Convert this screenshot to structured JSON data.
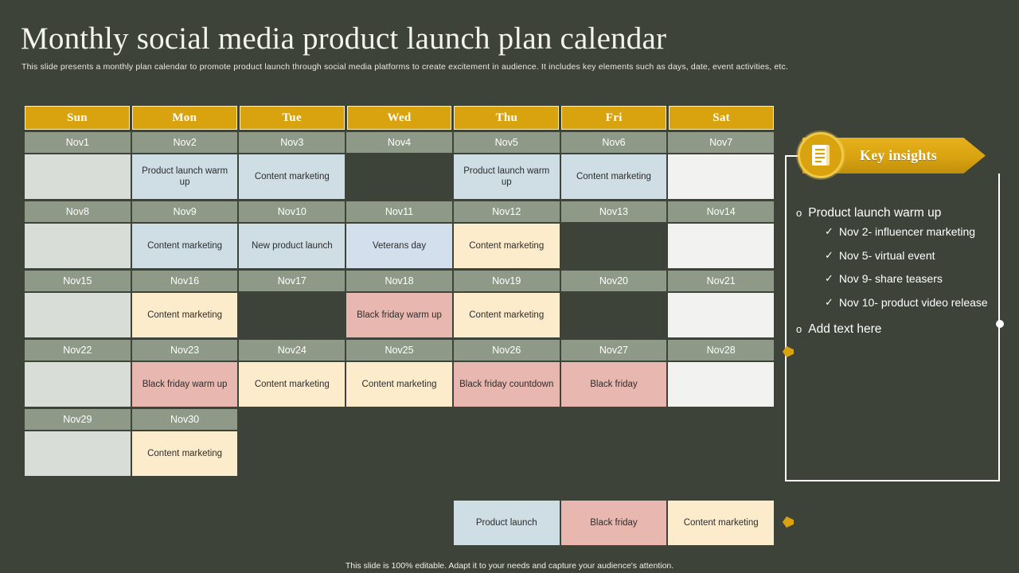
{
  "header": {
    "title": "Monthly social media product launch plan calendar",
    "subtitle": "This slide presents a monthly plan calendar to promote product launch through social media platforms to create excitement in audience. It includes key elements such as days, date, event activities, etc."
  },
  "calendar": {
    "day_headers": [
      "Sun",
      "Mon",
      "Tue",
      "Wed",
      "Thu",
      "Fri",
      "Sat"
    ],
    "weeks": [
      {
        "dates": [
          "Nov1",
          "Nov2",
          "Nov3",
          "Nov4",
          "Nov5",
          "Nov6",
          "Nov7"
        ],
        "events": [
          "",
          "Product launch warm up",
          "Content marketing",
          "",
          "Product launch warm up",
          "Content marketing",
          ""
        ],
        "colors": [
          "c-sun",
          "c-blue",
          "c-blue",
          "c-dark",
          "c-blue",
          "c-blue",
          "c-sat"
        ]
      },
      {
        "dates": [
          "Nov8",
          "Nov9",
          "Nov10",
          "Nov11",
          "Nov12",
          "Nov13",
          "Nov14"
        ],
        "events": [
          "",
          "Content marketing",
          "New product launch",
          "Veterans day",
          "Content marketing",
          "",
          ""
        ],
        "colors": [
          "c-sun",
          "c-blue",
          "c-blue",
          "c-bluer",
          "c-cream",
          "c-dark",
          "c-sat"
        ]
      },
      {
        "dates": [
          "Nov15",
          "Nov16",
          "Nov17",
          "Nov18",
          "Nov19",
          "Nov20",
          "Nov21"
        ],
        "events": [
          "",
          "Content marketing",
          "",
          "Black friday warm up",
          "Content marketing",
          "",
          ""
        ],
        "colors": [
          "c-sun",
          "c-cream",
          "c-dark",
          "c-pink",
          "c-cream",
          "c-dark",
          "c-sat"
        ]
      },
      {
        "dates": [
          "Nov22",
          "Nov23",
          "Nov24",
          "Nov25",
          "Nov26",
          "Nov27",
          "Nov28"
        ],
        "events": [
          "",
          "Black friday warm up",
          "Content marketing",
          "Content marketing",
          "Black friday countdown",
          "Black friday",
          ""
        ],
        "colors": [
          "c-sun",
          "c-pink",
          "c-cream",
          "c-cream",
          "c-pink",
          "c-pink",
          "c-sat"
        ]
      },
      {
        "dates": [
          "Nov29",
          "Nov30",
          "",
          "",
          "",
          "",
          ""
        ],
        "events": [
          "",
          "Content marketing",
          "",
          "",
          "",
          "",
          ""
        ],
        "colors": [
          "c-sun",
          "c-cream",
          "c-dark",
          "c-dark",
          "c-dark",
          "c-dark",
          "c-dark"
        ]
      },
      {
        "dates": [
          "",
          "",
          "",
          "",
          "",
          "",
          ""
        ],
        "events": [
          "",
          "",
          "",
          "",
          "Product launch",
          "Black friday",
          "Content marketing"
        ],
        "colors": [
          "c-dark",
          "c-dark",
          "c-dark",
          "c-dark",
          "c-blue",
          "c-pink",
          "c-cream"
        ]
      }
    ]
  },
  "insights": {
    "banner_label": "Key insights",
    "badge_icon": "document-list-icon",
    "groups": [
      {
        "label": "Product launch warm up",
        "bullet": "o",
        "items": [
          {
            "tick": "✓",
            "text": "Nov 2- influencer marketing"
          },
          {
            "tick": "✓",
            "text": "Nov 5- virtual event"
          },
          {
            "tick": "✓",
            "text": "Nov 9- share teasers"
          },
          {
            "tick": "✓",
            "text": "Nov 10- product video release"
          }
        ]
      },
      {
        "label": "Add text here",
        "bullet": "o",
        "items": []
      }
    ]
  },
  "footer": {
    "note": "This slide is 100% editable. Adapt it to your needs and capture your audience's attention."
  },
  "colors": {
    "background": "#3d4339",
    "accent_gold": "#d9a310",
    "accent_gold_light": "#f0c94a",
    "date_row": "#8e9a87",
    "blue": "#cfdee4",
    "blue_alt": "#d4dfee",
    "cream": "#fdeccc",
    "pink": "#e8b8b0",
    "sunday": "#d9ddd7",
    "saturday": "#f2f3f0"
  }
}
